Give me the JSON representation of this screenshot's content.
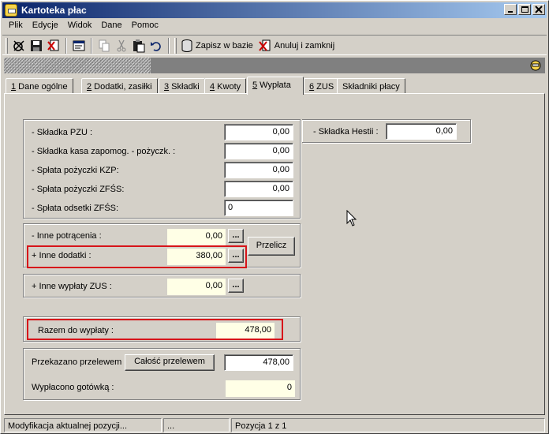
{
  "window": {
    "title": "Kartoteka płac"
  },
  "menu": [
    "Plik",
    "Edycje",
    "Widok",
    "Dane",
    "Pomoc"
  ],
  "toolbar": {
    "save_label": "Zapisz w bazie",
    "cancel_label": "Anuluj i zamknij"
  },
  "tabs": [
    {
      "key": "1",
      "label": " Dane ogólne"
    },
    {
      "key": "2",
      "label": " Dodatki, zasiłki"
    },
    {
      "key": "3",
      "label": " Składki"
    },
    {
      "key": "4",
      "label": " Kwoty"
    },
    {
      "key": "5",
      "label": " Wypłata"
    },
    {
      "key": "6",
      "label": " ZUS"
    },
    {
      "key": "",
      "label": "Składniki płacy"
    }
  ],
  "deductions": [
    {
      "label": "- Składka PZU :",
      "value": "0,00"
    },
    {
      "label": "- Składka kasa zapomog. - pożyczk. :",
      "value": "0,00"
    },
    {
      "label": "- Spłata pożyczki KZP:",
      "value": "0,00"
    },
    {
      "label": "- Spłata pożyczki ZFŚS:",
      "value": "0,00"
    },
    {
      "label": "- Spłata odsetki ZFŚS:",
      "value": "0"
    }
  ],
  "hestia": {
    "label": "- Składka Hestii :",
    "value": "0,00"
  },
  "other": {
    "inne_potracenia_label": "- Inne potrącenia :",
    "inne_potracenia_value": "0,00",
    "inne_dodatki_label": "+ Inne dodatki :",
    "inne_dodatki_value": "380,00",
    "przelicz_label": "Przelicz",
    "dots": "..."
  },
  "zus": {
    "label": "+ Inne wypłaty ZUS :",
    "value": "0,00"
  },
  "razem": {
    "label": "Razem do wypłaty :",
    "value": "478,00"
  },
  "transfer": {
    "przekazano_label": "Przekazano przelewem :",
    "calosc_button": "Całość przelewem",
    "przekazano_value": "478,00",
    "wyplacono_label": "Wypłacono gotówką :",
    "wyplacono_value": "0"
  },
  "status": {
    "message": "Modyfikacja aktualnej pozycji...",
    "middle": "...",
    "position": "Pozycja 1 z 1"
  },
  "colors": {
    "highlight": "#d7141a",
    "title_bar_start": "#0a246a"
  }
}
